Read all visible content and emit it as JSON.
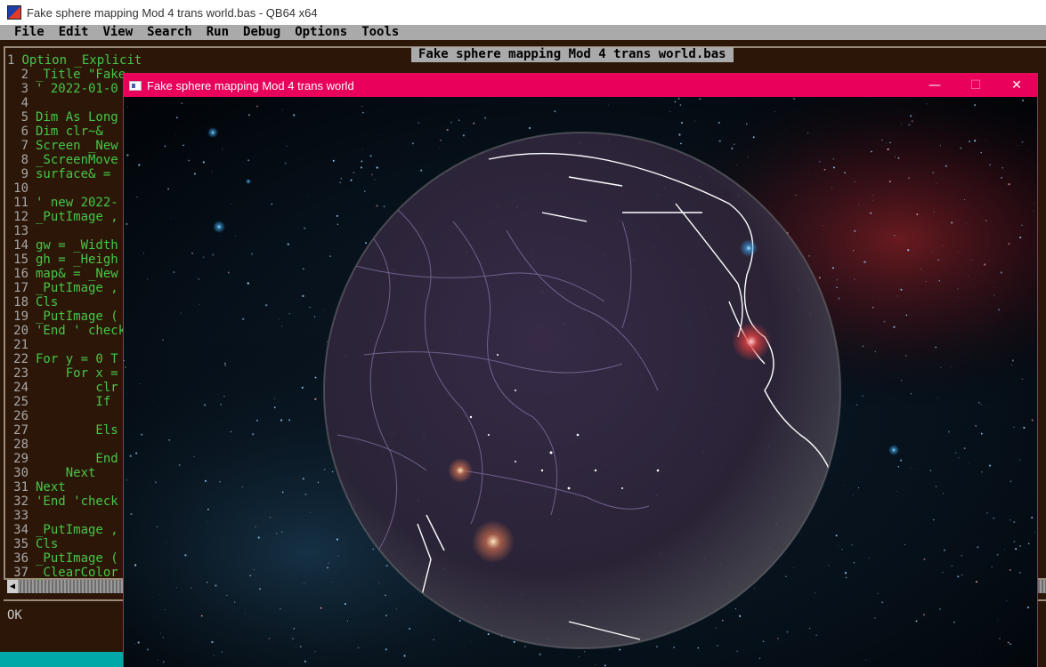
{
  "ide": {
    "title": "Fake sphere mapping Mod 4 trans world.bas - QB64 x64",
    "menu": [
      "File",
      "Edit",
      "View",
      "Search",
      "Run",
      "Debug",
      "Options",
      "Tools"
    ],
    "file_caption": "Fake sphere mapping Mod 4 trans world.bas",
    "status": "OK",
    "code_lines": [
      {
        "n": "1",
        "text": "Option _Explicit"
      },
      {
        "n": "2",
        "text": "_Title \"Fake"
      },
      {
        "n": "3",
        "text": "' 2022-01-0"
      },
      {
        "n": "4",
        "text": ""
      },
      {
        "n": "5",
        "text": "Dim As Long"
      },
      {
        "n": "6",
        "text": "Dim clr~&"
      },
      {
        "n": "7",
        "text": "Screen _New"
      },
      {
        "n": "8",
        "text": "_ScreenMove"
      },
      {
        "n": "9",
        "text": "surface& ="
      },
      {
        "n": "10",
        "text": ""
      },
      {
        "n": "11",
        "text": "' new 2022-"
      },
      {
        "n": "12",
        "text": "_PutImage ,"
      },
      {
        "n": "13",
        "text": ""
      },
      {
        "n": "14",
        "text": "gw = _Width"
      },
      {
        "n": "15",
        "text": "gh = _Heigh"
      },
      {
        "n": "16",
        "text": "map& = _New"
      },
      {
        "n": "17",
        "text": "_PutImage ,"
      },
      {
        "n": "18",
        "text": "Cls"
      },
      {
        "n": "19",
        "text": "_PutImage ("
      },
      {
        "n": "20",
        "text": "'End ' check"
      },
      {
        "n": "21",
        "text": ""
      },
      {
        "n": "22",
        "text": "For y = 0 T"
      },
      {
        "n": "23",
        "text": "    For x ="
      },
      {
        "n": "24",
        "text": "        clr"
      },
      {
        "n": "25",
        "text": "        If"
      },
      {
        "n": "26",
        "text": ""
      },
      {
        "n": "27",
        "text": "        Els"
      },
      {
        "n": "28",
        "text": ""
      },
      {
        "n": "29",
        "text": "        End"
      },
      {
        "n": "30",
        "text": "    Next"
      },
      {
        "n": "31",
        "text": "Next"
      },
      {
        "n": "32",
        "text": "'End 'check"
      },
      {
        "n": "33",
        "text": ""
      },
      {
        "n": "34",
        "text": "_PutImage ,"
      },
      {
        "n": "35",
        "text": "Cls"
      },
      {
        "n": "36",
        "text": "_PutImage ("
      },
      {
        "n": "37",
        "text": "_ClearColor"
      }
    ]
  },
  "program_window": {
    "title": "Fake sphere mapping Mod 4 trans world",
    "controls": {
      "minimize": "—",
      "maximize": "☐",
      "close": "✕"
    }
  },
  "colors": {
    "ide_background": "#2c1608",
    "code_text": "#46c646",
    "line_numbers": "#a8a8a8",
    "menubar": "#aaaaaa",
    "program_titlebar": "#e8005a",
    "status_cyan": "#00a8a8"
  }
}
